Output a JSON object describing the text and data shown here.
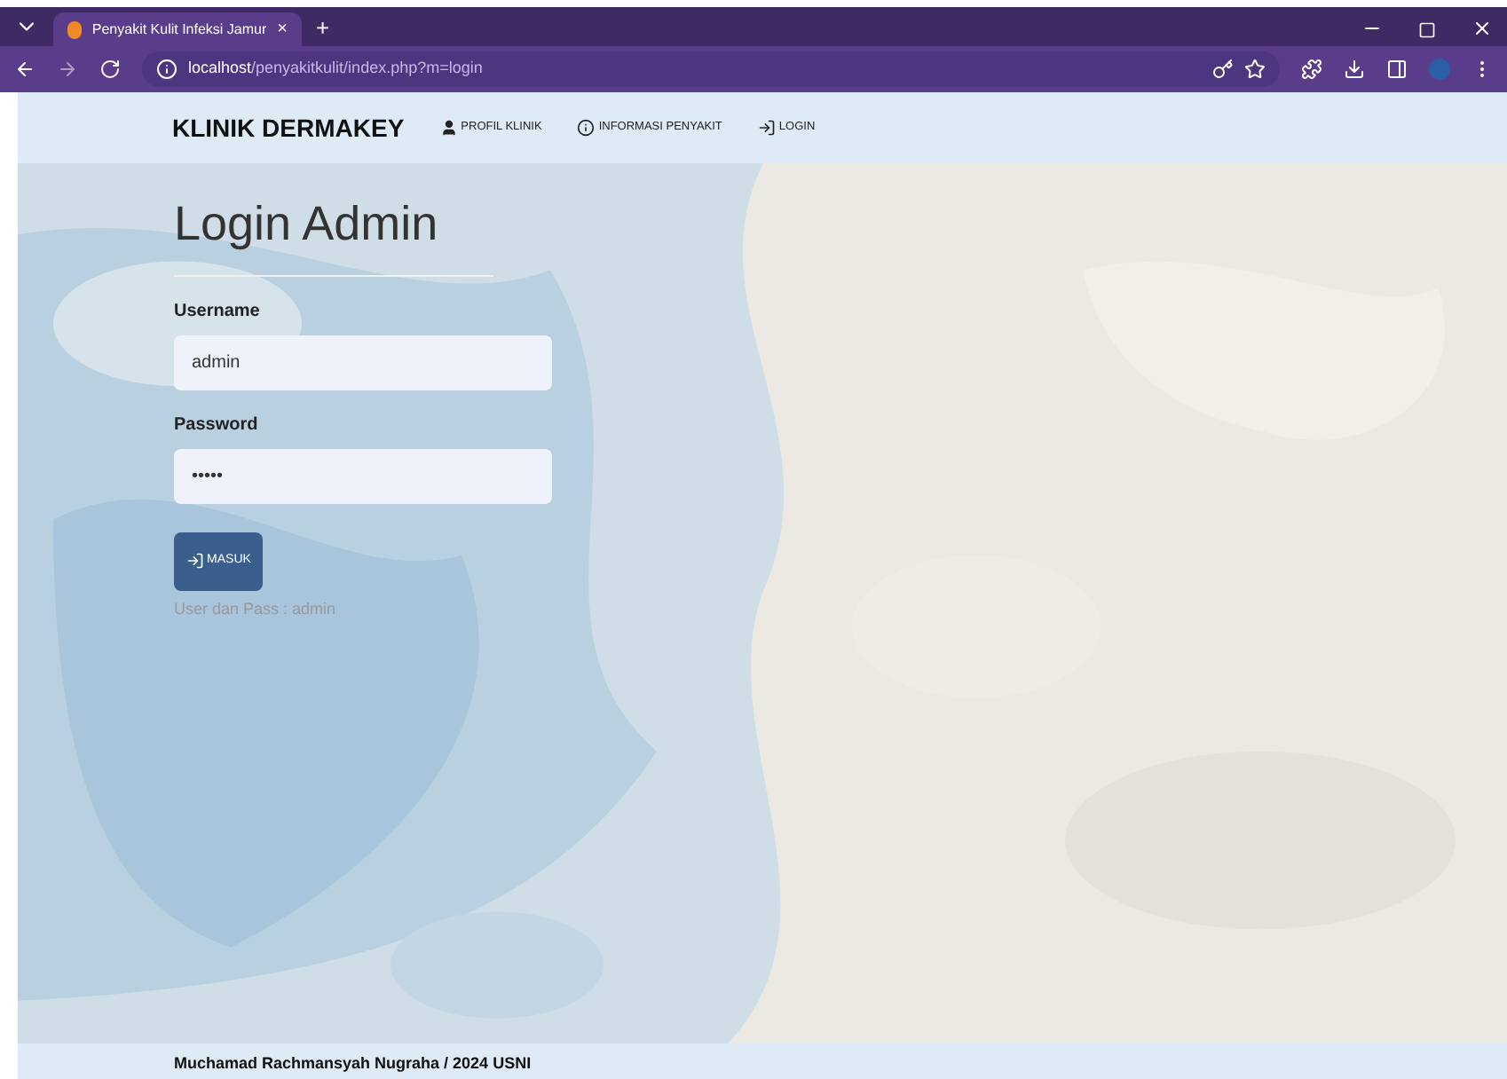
{
  "browser": {
    "tab": {
      "title": "Penyakit Kulit Infeksi Jamur",
      "close": "×"
    },
    "new_tab": "+",
    "url_host": "localhost",
    "url_path": "/penyakitkulit/index.php?m=login"
  },
  "navbar": {
    "brand": "KLINIK DERMAKEY",
    "links": [
      {
        "kind": "user",
        "label": "PROFIL KLINIK"
      },
      {
        "kind": "info",
        "label": "INFORMASI PENYAKIT"
      },
      {
        "kind": "login",
        "label": "LOGIN"
      }
    ]
  },
  "login": {
    "title": "Login Admin",
    "fields": [
      {
        "label": "Username",
        "value": "admin"
      },
      {
        "label": "Password",
        "value": "•••••"
      }
    ],
    "button": "MASUK",
    "hint": "User dan Pass : admin"
  },
  "footer": "Muchamad Rachmansyah Nugraha / 2024 USNI"
}
